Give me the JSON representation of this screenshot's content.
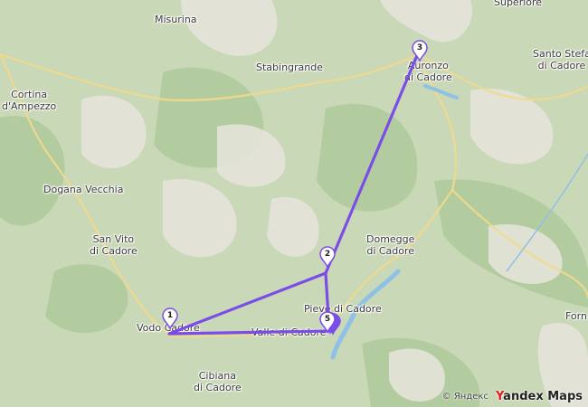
{
  "map": {
    "colors": {
      "base": "#c9d8b6",
      "forest": "#a9c795",
      "rock": "#e6e4dc",
      "road": "#f3d98a",
      "water": "#8fc0e6",
      "route": "#7a4de8"
    },
    "places": [
      {
        "name": "place-superiore",
        "lines": [
          "Superiore"
        ]
      },
      {
        "name": "place-misurina",
        "lines": [
          "Misurina"
        ]
      },
      {
        "name": "place-stabingrande",
        "lines": [
          "Stabingrande"
        ]
      },
      {
        "name": "place-auronzo",
        "lines": [
          "Auronzo",
          "di Cadore"
        ]
      },
      {
        "name": "place-santo-stefano",
        "lines": [
          "Santo Stefa",
          "di Cadore"
        ]
      },
      {
        "name": "place-cortina",
        "lines": [
          "Cortina",
          "d'Ampezzo"
        ]
      },
      {
        "name": "place-dogana-vecchia",
        "lines": [
          "Dogana Vecchia"
        ]
      },
      {
        "name": "place-san-vito",
        "lines": [
          "San Vito",
          "di Cadore"
        ]
      },
      {
        "name": "place-domegge",
        "lines": [
          "Domegge",
          "di Cadore"
        ]
      },
      {
        "name": "place-pieve",
        "lines": [
          "Pieve di Cadore"
        ]
      },
      {
        "name": "place-vodo",
        "lines": [
          "Vodo Cadore"
        ]
      },
      {
        "name": "place-valle",
        "lines": [
          "Valle di Cadore"
        ]
      },
      {
        "name": "place-forn",
        "lines": [
          "Forn"
        ]
      },
      {
        "name": "place-cibiana",
        "lines": [
          "Cibiana",
          "di Cadore"
        ]
      }
    ],
    "markers": [
      {
        "label": "1"
      },
      {
        "label": "2"
      },
      {
        "label": "3"
      },
      {
        "label": "5"
      }
    ],
    "attribution": {
      "copyright": "© Яндекс",
      "logo_y": "Y",
      "logo_rest": "andex Maps"
    }
  }
}
